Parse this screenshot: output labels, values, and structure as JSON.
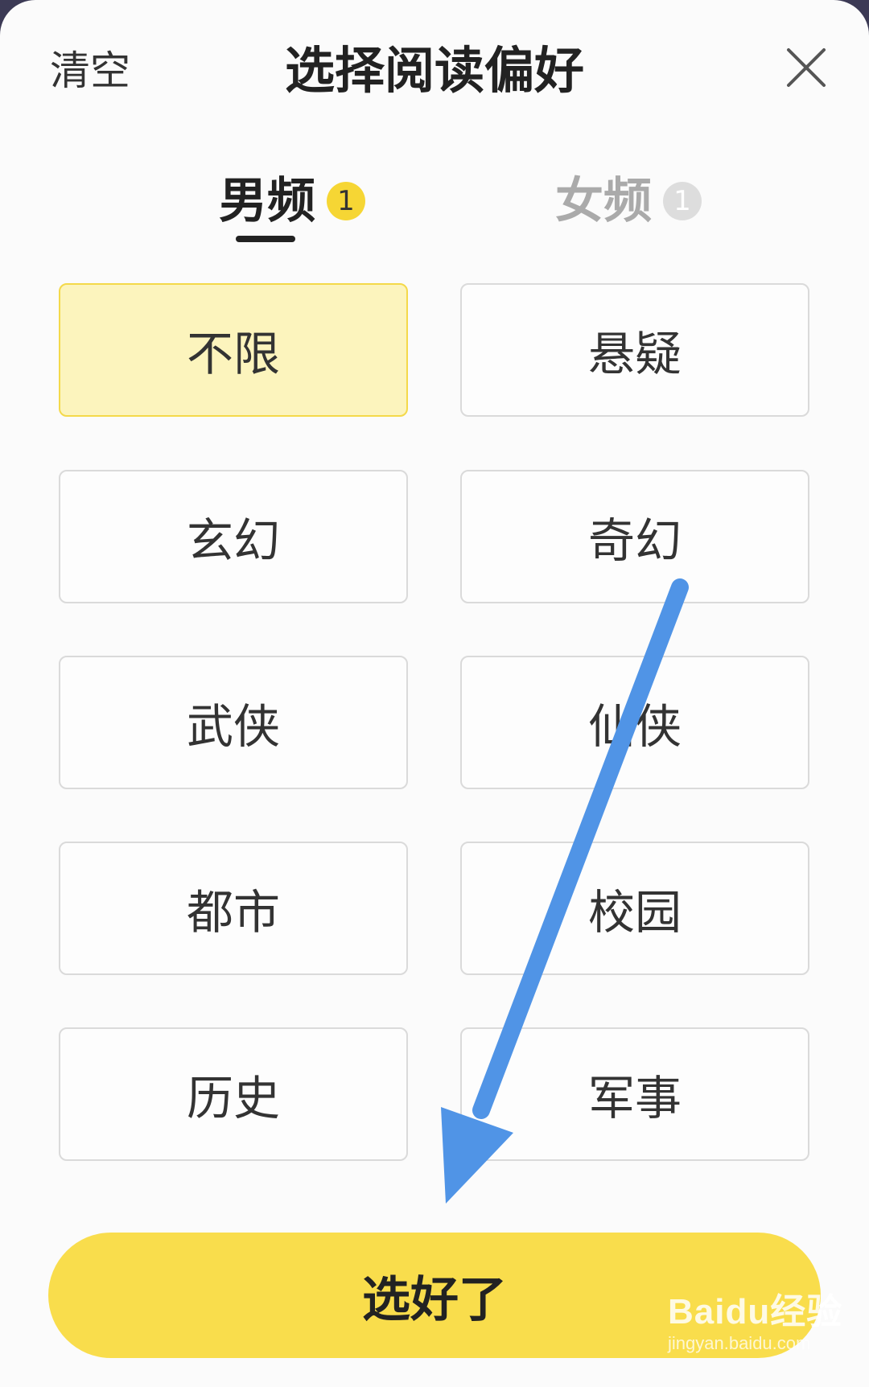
{
  "header": {
    "clear_label": "清空",
    "title": "选择阅读偏好",
    "close_icon": "close-icon"
  },
  "tabs": [
    {
      "label": "男频",
      "badge": "1",
      "active": true
    },
    {
      "label": "女频",
      "badge": "1",
      "active": false
    }
  ],
  "genres": [
    {
      "label": "不限",
      "selected": true
    },
    {
      "label": "悬疑",
      "selected": false
    },
    {
      "label": "玄幻",
      "selected": false
    },
    {
      "label": "奇幻",
      "selected": false
    },
    {
      "label": "武侠",
      "selected": false
    },
    {
      "label": "仙侠",
      "selected": false
    },
    {
      "label": "都市",
      "selected": false
    },
    {
      "label": "校园",
      "selected": false
    },
    {
      "label": "历史",
      "selected": false
    },
    {
      "label": "军事",
      "selected": false
    }
  ],
  "confirm_label": "选好了",
  "annotation": {
    "arrow_color": "#5094e6"
  },
  "colors": {
    "accent": "#f9dd4c",
    "selected_bg": "#fcf4bd",
    "selected_border": "#f4d94a"
  },
  "watermark": {
    "main": "Baidu经验",
    "sub": "jingyan.baidu.com"
  }
}
